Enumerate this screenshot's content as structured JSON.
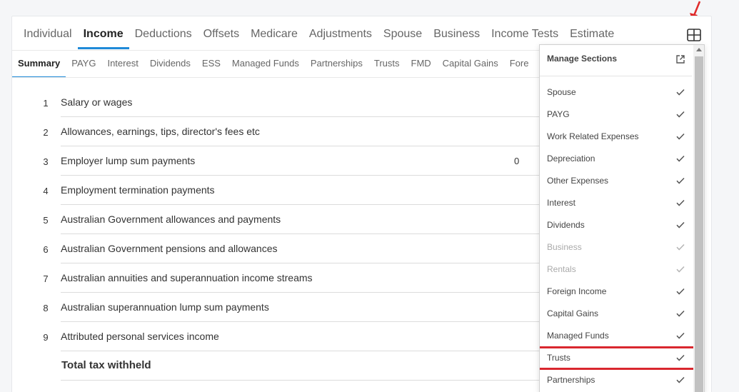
{
  "top_tabs": [
    "Individual",
    "Income",
    "Deductions",
    "Offsets",
    "Medicare",
    "Adjustments",
    "Spouse",
    "Business",
    "Income Tests",
    "Estimate"
  ],
  "active_top_tab": "Income",
  "sub_tabs": [
    "Summary",
    "PAYG",
    "Interest",
    "Dividends",
    "ESS",
    "Managed Funds",
    "Partnerships",
    "Trusts",
    "FMD",
    "Capital Gains",
    "Fore"
  ],
  "active_sub_tab": "Summary",
  "rows": [
    {
      "num": "1",
      "label": "Salary or wages",
      "value": ""
    },
    {
      "num": "2",
      "label": "Allowances, earnings, tips, director's fees etc",
      "value": ""
    },
    {
      "num": "3",
      "label": "Employer lump sum payments",
      "value": "0"
    },
    {
      "num": "4",
      "label": "Employment termination payments",
      "value": ""
    },
    {
      "num": "5",
      "label": "Australian Government allowances and payments",
      "value": ""
    },
    {
      "num": "6",
      "label": "Australian Government pensions and allowances",
      "value": ""
    },
    {
      "num": "7",
      "label": "Australian annuities and superannuation income streams",
      "value": ""
    },
    {
      "num": "8",
      "label": "Australian superannuation lump sum payments",
      "value": ""
    },
    {
      "num": "9",
      "label": "Attributed personal services income",
      "value": ""
    }
  ],
  "total_label": "Total tax withheld",
  "manage_sections": {
    "title": "Manage Sections",
    "items": [
      {
        "label": "Spouse",
        "checked": true,
        "disabled": false
      },
      {
        "label": "PAYG",
        "checked": true,
        "disabled": false
      },
      {
        "label": "Work Related Expenses",
        "checked": true,
        "disabled": false
      },
      {
        "label": "Depreciation",
        "checked": true,
        "disabled": false
      },
      {
        "label": "Other Expenses",
        "checked": true,
        "disabled": false
      },
      {
        "label": "Interest",
        "checked": true,
        "disabled": false
      },
      {
        "label": "Dividends",
        "checked": true,
        "disabled": false
      },
      {
        "label": "Business",
        "checked": true,
        "disabled": true
      },
      {
        "label": "Rentals",
        "checked": true,
        "disabled": true
      },
      {
        "label": "Foreign Income",
        "checked": true,
        "disabled": false
      },
      {
        "label": "Capital Gains",
        "checked": true,
        "disabled": false
      },
      {
        "label": "Managed Funds",
        "checked": true,
        "disabled": false
      },
      {
        "label": "Trusts",
        "checked": true,
        "disabled": false,
        "highlighted": true
      },
      {
        "label": "Partnerships",
        "checked": true,
        "disabled": false
      }
    ]
  },
  "colors": {
    "accent": "#1f8ad8",
    "highlight": "#d9272e",
    "check": "#555555",
    "check_disabled": "#b5b5b5"
  }
}
